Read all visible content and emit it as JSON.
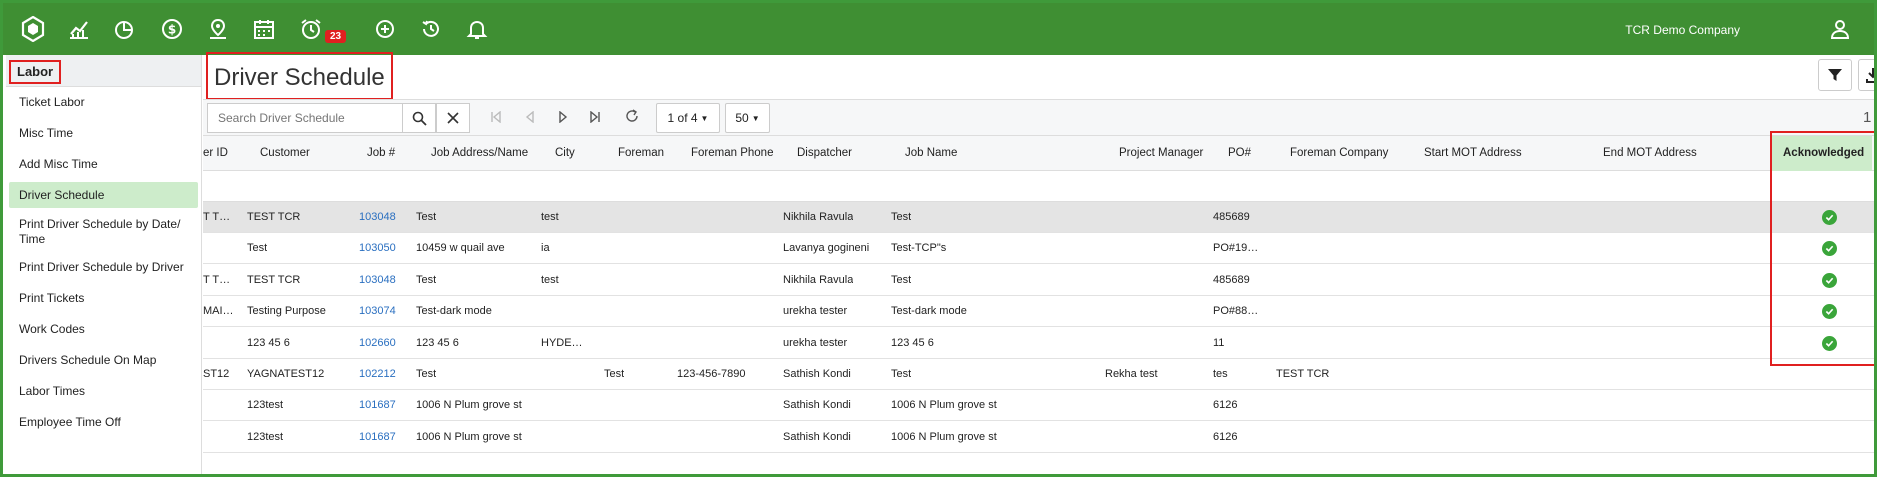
{
  "topbar": {
    "company": "TCR Demo Company",
    "badge_count": "23",
    "icons": [
      "hexagon-logo-icon",
      "chart-icon",
      "pie-chart-icon",
      "dollar-icon",
      "location-icon",
      "calendar-icon",
      "alarm-clock-icon",
      "plus-circle-icon",
      "history-icon",
      "bell-icon",
      "user-icon"
    ],
    "bg_color": "#3f8f33"
  },
  "sidebar": {
    "header": "Labor",
    "items": [
      {
        "label": "Ticket Labor"
      },
      {
        "label": "Misc Time"
      },
      {
        "label": "Add Misc Time"
      },
      {
        "label": "Driver Schedule",
        "active": true
      },
      {
        "label": "Print Driver Schedule by Date/ Time"
      },
      {
        "label": "Print Driver Schedule by Driver"
      },
      {
        "label": "Print Tickets"
      },
      {
        "label": "Work Codes"
      },
      {
        "label": "Drivers Schedule On Map"
      },
      {
        "label": "Labor Times"
      },
      {
        "label": "Employee Time Off"
      }
    ]
  },
  "page": {
    "title": "Driver Schedule"
  },
  "toolbar": {
    "search_placeholder": "Search Driver Schedule",
    "page_select": "1 of 4",
    "page_size": "50",
    "right_number": "1"
  },
  "table": {
    "columns": [
      "er ID",
      "Customer",
      "Job #",
      "Job Address/Name",
      "City",
      "Foreman",
      "Foreman Phone",
      "Dispatcher",
      "Job Name",
      "Project Manager",
      "PO#",
      "Foreman Company",
      "Start MOT Address",
      "End MOT Address",
      "Acknowledged"
    ],
    "rows": [
      {
        "driver_id": "T T…",
        "customer": "TEST TCR",
        "job": "103048",
        "address": "Test",
        "city": "test",
        "foreman": "",
        "foreman_phone": "",
        "dispatcher": "Nikhila Ravula",
        "job_name": "Test",
        "pm": "",
        "po": "485689",
        "foreman_company": "",
        "ack": true,
        "selected": true
      },
      {
        "driver_id": "",
        "customer": "Test",
        "job": "103050",
        "address": "10459 w quail ave",
        "city": "ia",
        "foreman": "",
        "foreman_phone": "",
        "dispatcher": "Lavanya gogineni",
        "job_name": "Test-TCP\"s",
        "pm": "",
        "po": "PO#19…",
        "foreman_company": "",
        "ack": true
      },
      {
        "driver_id": "T T…",
        "customer": "TEST TCR",
        "job": "103048",
        "address": "Test",
        "city": "test",
        "foreman": "",
        "foreman_phone": "",
        "dispatcher": "Nikhila Ravula",
        "job_name": "Test",
        "pm": "",
        "po": "485689",
        "foreman_company": "",
        "ack": true
      },
      {
        "driver_id": "MAI…",
        "customer": "Testing Purpose",
        "job": "103074",
        "address": "Test-dark mode",
        "city": "",
        "foreman": "",
        "foreman_phone": "",
        "dispatcher": "urekha tester",
        "job_name": "Test-dark mode",
        "pm": "",
        "po": "PO#88…",
        "foreman_company": "",
        "ack": true
      },
      {
        "driver_id": "",
        "customer": "123 45 6",
        "job": "102660",
        "address": "123 45 6",
        "city": "HYDE…",
        "foreman": "",
        "foreman_phone": "",
        "dispatcher": "urekha tester",
        "job_name": "123 45 6",
        "pm": "",
        "po": "11",
        "foreman_company": "",
        "ack": true
      },
      {
        "driver_id": "ST12",
        "customer": "YAGNATEST12",
        "job": "102212",
        "address": "Test",
        "city": "",
        "foreman": "Test",
        "foreman_phone": "123-456-7890",
        "dispatcher": "Sathish Kondi",
        "job_name": "Test",
        "pm": "Rekha test",
        "po": "tes",
        "foreman_company": "TEST TCR",
        "ack": false
      },
      {
        "driver_id": "",
        "customer": "123test",
        "job": "101687",
        "address": "1006 N Plum grove st",
        "city": "",
        "foreman": "",
        "foreman_phone": "",
        "dispatcher": "Sathish Kondi",
        "job_name": "1006 N Plum grove st",
        "pm": "",
        "po": "6126",
        "foreman_company": "",
        "ack": false
      },
      {
        "driver_id": "",
        "customer": "123test",
        "job": "101687",
        "address": "1006 N Plum grove st",
        "city": "",
        "foreman": "",
        "foreman_phone": "",
        "dispatcher": "Sathish Kondi",
        "job_name": "1006 N Plum grove st",
        "pm": "",
        "po": "6126",
        "foreman_company": "",
        "ack": false
      }
    ]
  }
}
